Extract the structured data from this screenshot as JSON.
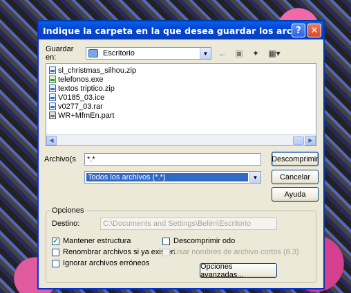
{
  "window": {
    "title": "Indique la carpeta en la que desea guardar los archivos.",
    "help_glyph": "?",
    "close_glyph": "✕"
  },
  "location": {
    "label": "Guardar en:",
    "value": "Escritorio"
  },
  "toolbar": {
    "back_glyph": "←",
    "up_glyph": "▣",
    "new_folder_glyph": "✦",
    "view_glyph": "▦▾"
  },
  "files": [
    {
      "name": "sl_christmas_silhou.zip",
      "icon": "zip-icon"
    },
    {
      "name": "telefonos.exe",
      "icon": "exe-icon"
    },
    {
      "name": "textos triptico.zip",
      "icon": "zip-icon"
    },
    {
      "name": "V0185_03.ice",
      "icon": "file-icon"
    },
    {
      "name": "v0277_03.rar",
      "icon": "rar-icon"
    },
    {
      "name": "WR+MfmEn.part",
      "icon": "part-icon"
    }
  ],
  "archivo": {
    "label": "Archivo(s",
    "value": "*.*"
  },
  "filetype": {
    "value": "Todos los archivos (*.*)"
  },
  "buttons": {
    "descomprimir": "Descomprimir",
    "cancelar": "Cancelar",
    "ayuda": "Ayuda",
    "opciones_avanzadas": "Opciones avanzadas..."
  },
  "opciones": {
    "legend": "Opciones",
    "destino_label": "Destino:",
    "destino_value": "C:\\Documents and Settings\\Belén\\Escritorio",
    "mantener": {
      "label": "Mantener estructura",
      "checked": true
    },
    "renombrar": {
      "label": "Renombrar archivos si ya existen",
      "checked": false
    },
    "ignorar": {
      "label": "Ignorar archivos erróneos",
      "checked": false
    },
    "descomprimir_todo": {
      "label": "Descomprimir odo",
      "checked": false
    },
    "usar_nombres": {
      "label": "Usar nombres de archivo cortos (8.3)",
      "checked": false,
      "disabled": true
    }
  },
  "colors": {
    "titlebar": "#0a5fea",
    "selection": "#316ac5",
    "dialog_bg": "#ece9d8"
  }
}
